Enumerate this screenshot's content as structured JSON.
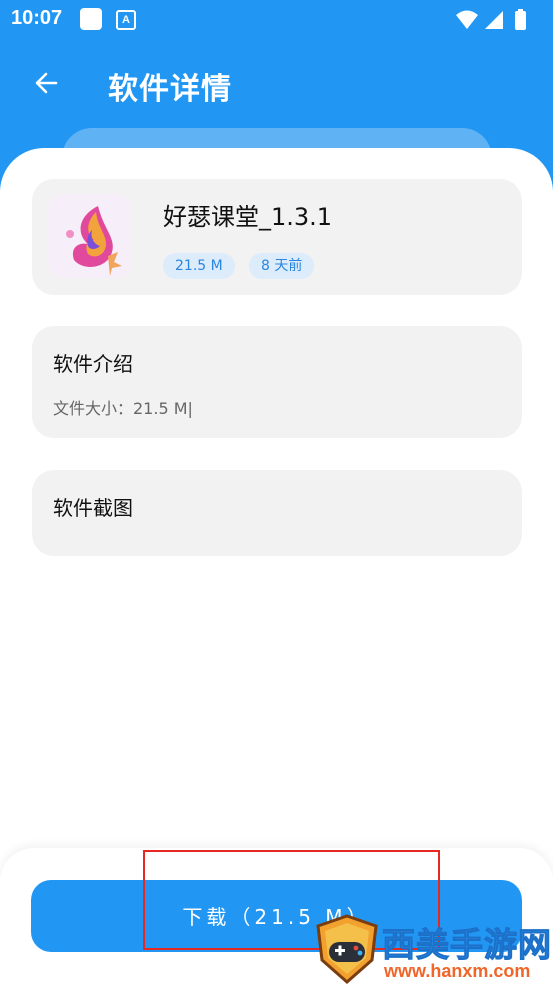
{
  "status_bar": {
    "time": "10:07",
    "small_icon_letter": "A"
  },
  "header": {
    "title": "软件详情"
  },
  "app": {
    "name": "好瑟课堂_1.3.1",
    "size_tag": "21.5 M",
    "time_tag": "8 天前"
  },
  "intro": {
    "title": "软件介绍",
    "file_size_text": "文件大小：21.5 M|"
  },
  "screenshots": {
    "title": "软件截图"
  },
  "download": {
    "label": "下载（21.5 M）"
  },
  "watermark": {
    "site_name": "西美手游网",
    "url": "www.hanxm.com"
  },
  "colors": {
    "primary": "#2196f3",
    "card_bg": "#f2f2f2",
    "tag_bg": "#dcecfb",
    "tag_text": "#2a86e0",
    "highlight_box": "#e52920",
    "watermark_blue": "#2d93f0",
    "watermark_orange": "#f0652a"
  },
  "icons": [
    "back-arrow-icon",
    "wifi-icon",
    "signal-icon",
    "battery-icon",
    "app-logo-icon",
    "game-controller-shield-icon"
  ]
}
